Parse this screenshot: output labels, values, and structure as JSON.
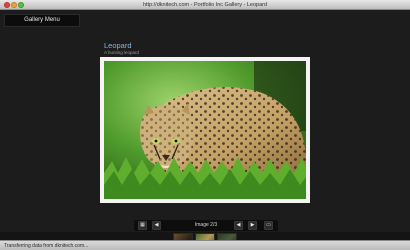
{
  "window": {
    "title": "http://dknitech.com - Portfolio Inc Gallery - Leopard"
  },
  "menu": {
    "label": "Gallery Menu"
  },
  "photo": {
    "title": "Leopard",
    "caption": "A hunting leopard"
  },
  "toolbar": {
    "image_counter": "Image 2/3"
  },
  "status": {
    "text": "Transferring data from dknitech.com..."
  },
  "icons": {
    "close": "close-icon",
    "minimize": "minimize-icon",
    "zoom": "zoom-icon",
    "grid": "grid-icon",
    "previous-set": "previous-icon",
    "previous": "previous-image-icon",
    "play": "play-icon",
    "fullscreen": "fullscreen-icon"
  }
}
